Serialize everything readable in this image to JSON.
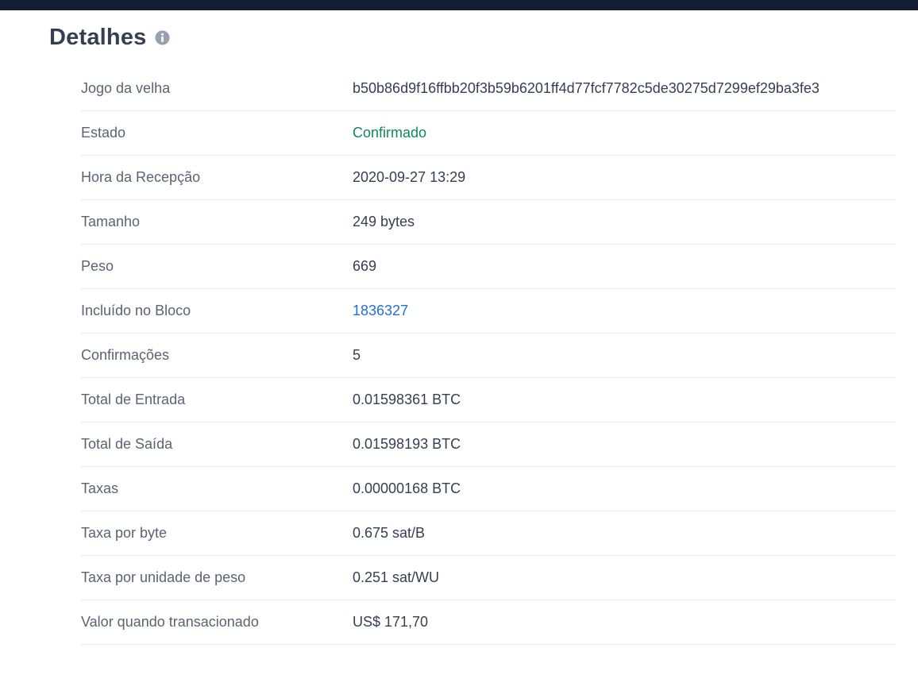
{
  "header": {
    "title": "Detalhes",
    "info_icon": "info-circle-icon"
  },
  "colors": {
    "topbar": "#121d33",
    "confirmed": "#0e8a5c",
    "link": "#1f6fe5"
  },
  "details": [
    {
      "label": "Jogo da velha",
      "value": "b50b86d9f16ffbb20f3b59b6201ff4d77fcf7782c5de30275d7299ef29ba3fe3"
    },
    {
      "label": "Estado",
      "value": "Confirmado"
    },
    {
      "label": "Hora da Recepção",
      "value": "2020-09-27 13:29"
    },
    {
      "label": "Tamanho",
      "value": "249 bytes"
    },
    {
      "label": "Peso",
      "value": "669"
    },
    {
      "label": "Incluído no Bloco",
      "value": "1836327"
    },
    {
      "label": "Confirmações",
      "value": "5"
    },
    {
      "label": "Total de Entrada",
      "value": "0.01598361 BTC"
    },
    {
      "label": "Total de Saída",
      "value": "0.01598193 BTC"
    },
    {
      "label": "Taxas",
      "value": "0.00000168 BTC"
    },
    {
      "label": "Taxa por byte",
      "value": "0.675 sat/B"
    },
    {
      "label": "Taxa por unidade de peso",
      "value": "0.251 sat/WU"
    },
    {
      "label": "Valor quando transacionado",
      "value": "US$ 171,70"
    }
  ]
}
